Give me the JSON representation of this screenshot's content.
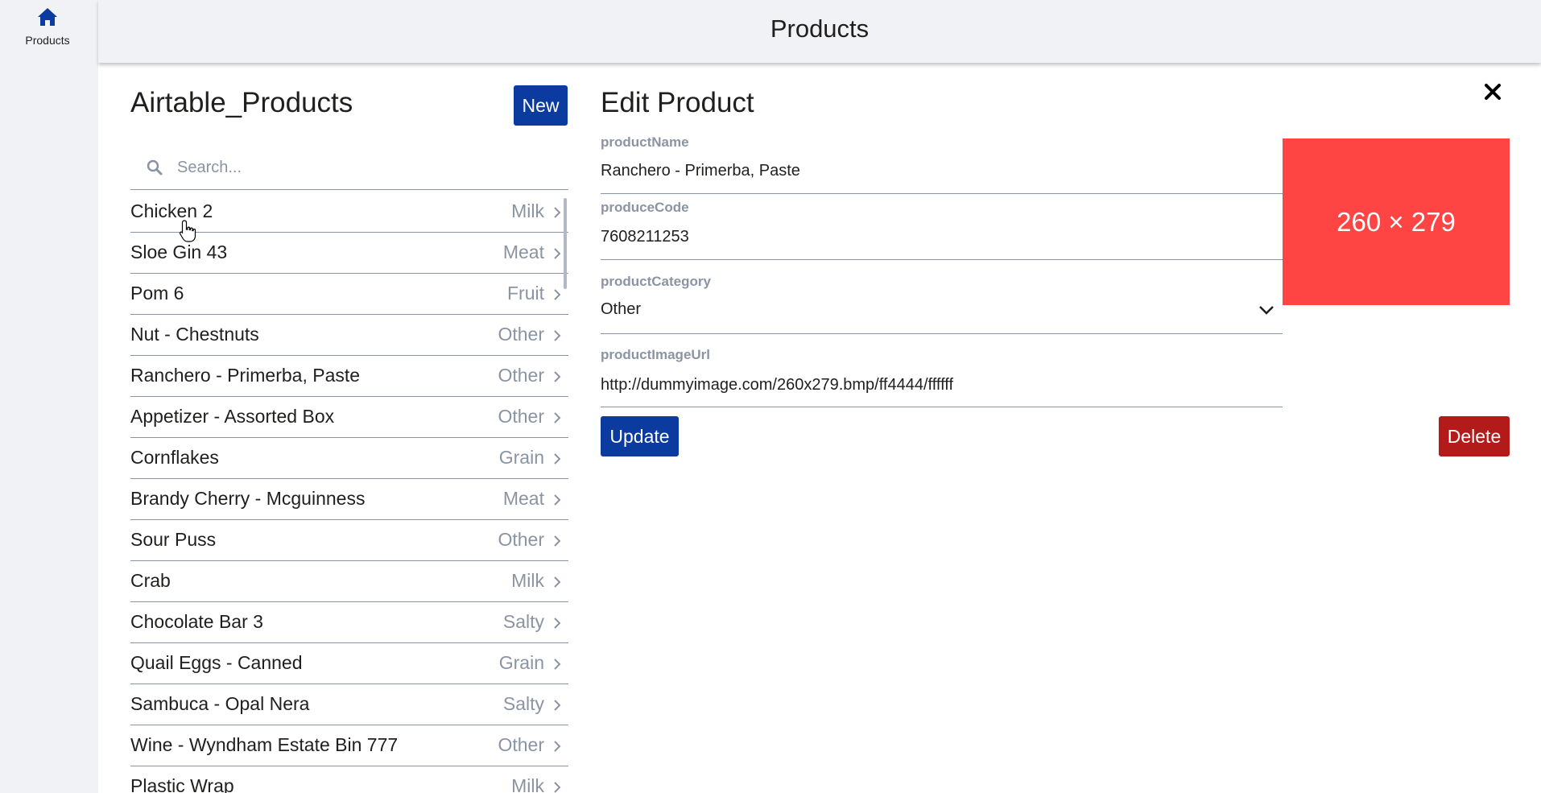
{
  "nav": {
    "items": [
      {
        "label": "Products",
        "icon": "home-icon"
      }
    ]
  },
  "header": {
    "title": "Products"
  },
  "list_panel": {
    "title": "Airtable_Products",
    "new_label": "New",
    "search_placeholder": "Search...",
    "items": [
      {
        "name": "Chicken 2",
        "category": "Milk"
      },
      {
        "name": "Sloe Gin 43",
        "category": "Meat"
      },
      {
        "name": "Pom 6",
        "category": "Fruit"
      },
      {
        "name": "Nut - Chestnuts",
        "category": "Other"
      },
      {
        "name": "Ranchero - Primerba, Paste",
        "category": "Other"
      },
      {
        "name": "Appetizer - Assorted Box",
        "category": "Other"
      },
      {
        "name": "Cornflakes",
        "category": "Grain"
      },
      {
        "name": "Brandy Cherry - Mcguinness",
        "category": "Meat"
      },
      {
        "name": "Sour Puss",
        "category": "Other"
      },
      {
        "name": "Crab",
        "category": "Milk"
      },
      {
        "name": "Chocolate Bar 3",
        "category": "Salty"
      },
      {
        "name": "Quail Eggs - Canned",
        "category": "Grain"
      },
      {
        "name": "Sambuca - Opal Nera",
        "category": "Salty"
      },
      {
        "name": "Wine - Wyndham Estate Bin 777",
        "category": "Other"
      },
      {
        "name": "Plastic Wrap",
        "category": "Milk"
      }
    ]
  },
  "edit_panel": {
    "title": "Edit Product",
    "fields": {
      "product_name": {
        "label": "productName",
        "value": "Ranchero - Primerba, Paste"
      },
      "produce_code": {
        "label": "produceCode",
        "value": "7608211253"
      },
      "product_category": {
        "label": "productCategory",
        "value": "Other"
      },
      "product_image_url": {
        "label": "productImageUrl",
        "value": "http://dummyimage.com/260x279.bmp/ff4444/ffffff"
      }
    },
    "image_text": "260 × 279",
    "update_label": "Update",
    "delete_label": "Delete"
  },
  "colors": {
    "primary": "#0b3b9e",
    "danger": "#b31b1b",
    "image_bg": "#ff4444",
    "muted": "#8a94a3"
  }
}
